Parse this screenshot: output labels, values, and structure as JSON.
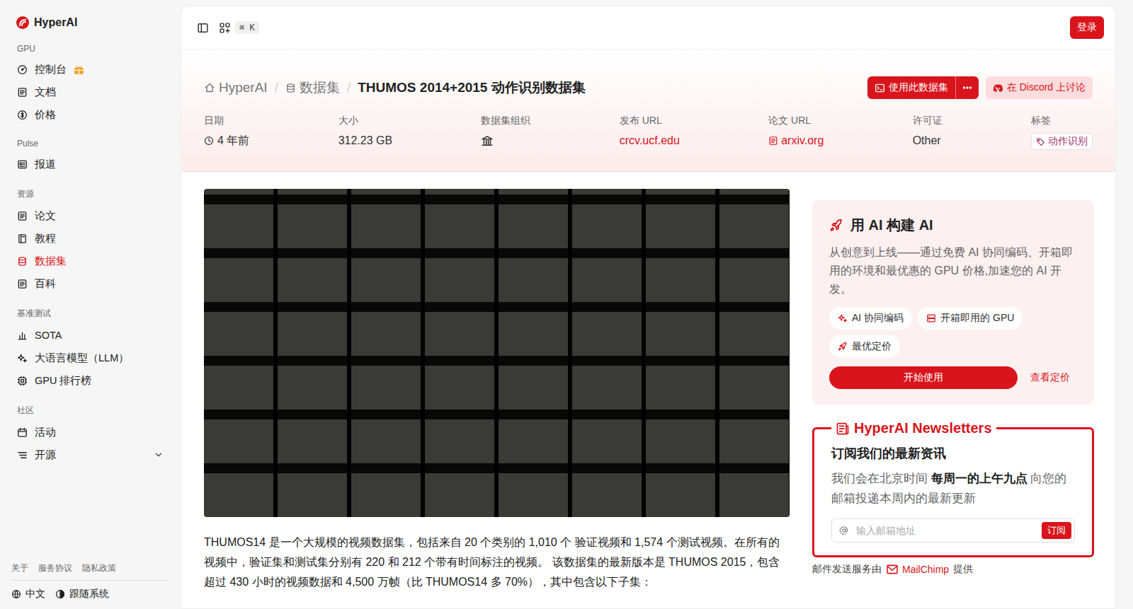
{
  "brand": {
    "name": "HyperAI"
  },
  "sidebar": {
    "sections": [
      {
        "title": "GPU",
        "items": [
          {
            "label": "控制台",
            "selected": false,
            "badge": true,
            "kind": "link"
          },
          {
            "label": "文档",
            "selected": false,
            "badge": false,
            "kind": "link"
          },
          {
            "label": "价格",
            "selected": false,
            "badge": false,
            "kind": "link"
          }
        ]
      },
      {
        "title": "Pulse",
        "items": [
          {
            "label": "报道",
            "selected": false,
            "badge": false,
            "kind": "link"
          }
        ]
      },
      {
        "title": "资源",
        "items": [
          {
            "label": "论文",
            "selected": false,
            "badge": false,
            "kind": "link"
          },
          {
            "label": "教程",
            "selected": false,
            "badge": false,
            "kind": "link"
          },
          {
            "label": "数据集",
            "selected": true,
            "badge": false,
            "kind": "link"
          },
          {
            "label": "百科",
            "selected": false,
            "badge": false,
            "kind": "link"
          }
        ]
      },
      {
        "title": "基准测试",
        "items": [
          {
            "label": "SOTA",
            "selected": false,
            "badge": false,
            "kind": "link"
          },
          {
            "label": "大语言模型（LLM）",
            "selected": false,
            "badge": false,
            "kind": "link"
          },
          {
            "label": "GPU 排行榜",
            "selected": false,
            "badge": false,
            "kind": "link"
          }
        ]
      },
      {
        "title": "社区",
        "items": [
          {
            "label": "活动",
            "selected": false,
            "badge": false,
            "kind": "link"
          },
          {
            "label": "开源",
            "selected": false,
            "badge": false,
            "kind": "group",
            "expanded": false
          }
        ]
      }
    ],
    "footer_links": [
      "关于",
      "服务协议",
      "隐私政策"
    ],
    "language": "中文",
    "theme": "跟随系统"
  },
  "topbar": {
    "shortcut": "⌘ K",
    "login": "登录"
  },
  "header": {
    "breadcrumb": [
      "HyperAI",
      "数据集",
      "THUMOS 2014+2015 动作识别数据集"
    ],
    "separator": "/",
    "use_button": "使用此数据集",
    "discord_button": "在 Discord 上讨论",
    "meta": [
      {
        "label": "日期",
        "value": "4 年前",
        "kind": "date"
      },
      {
        "label": "大小",
        "value": "312.23 GB",
        "kind": "text"
      },
      {
        "label": "数据集组织",
        "value": "",
        "kind": "org"
      },
      {
        "label": "发布 URL",
        "value": "crcv.ucf.edu",
        "kind": "link"
      },
      {
        "label": "论文 URL",
        "value": "arxiv.org",
        "kind": "paper"
      },
      {
        "label": "许可证",
        "value": "Other",
        "kind": "text"
      },
      {
        "label": "标签",
        "value": "动作识别",
        "kind": "tag"
      }
    ]
  },
  "description": "THUMOS14 是一个大规模的视频数据集，包括来自 20 个类别的 1,010 个 验证视频和 1,574 个测试视频。在所有的视频中，验证集和测试集分别有 220 和 212 个带有时间标注的视频。 该数据集的最新版本是 THUMOS 2015，包含超过 430 小时的视频数据和 4,500 万帧（比 THUMOS14 多 70%），其中包含以下子集：",
  "promo": {
    "title": "用 AI 构建 AI",
    "text": "从创意到上线——通过免费 AI 协同编码、开箱即用的环境和最优惠的 GPU 价格,加速您的 AI 开发。",
    "chips": [
      "AI 协同编码",
      "开箱即用的 GPU",
      "最优定价"
    ],
    "primary": "开始使用",
    "link": "查看定价"
  },
  "newsletter": {
    "title": "HyperAI Newsletters",
    "heading": "订阅我们的最新资讯",
    "text": [
      {
        "text": "我们会在北京时间 ",
        "bold": false
      },
      {
        "text": "每周一的上午九点",
        "bold": true
      },
      {
        "text": " 向您的邮箱投递本周内的最新更新",
        "bold": false
      }
    ],
    "placeholder": "输入邮箱地址",
    "button": "订阅",
    "footer": [
      "邮件发送服务由",
      "MailChimp",
      "提供"
    ]
  }
}
